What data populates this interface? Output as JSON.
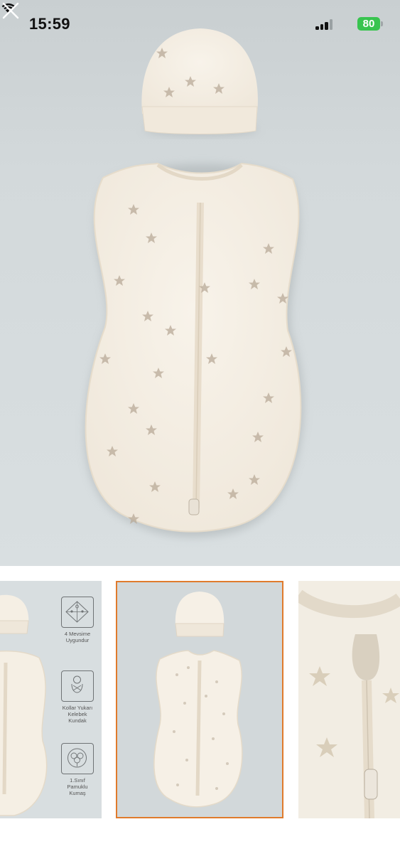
{
  "status_bar": {
    "time": "15:59",
    "battery_percent": "80",
    "signal_bars_active": 3,
    "signal_bars_total": 4
  },
  "header": {
    "close_icon": "close-icon"
  },
  "gallery": {
    "selected_index": 1,
    "accent_color": "#e07b2c",
    "thumbnails": [
      {
        "features": [
          {
            "icon": "four-seasons-icon",
            "label": "4 Mevsime Uygundur"
          },
          {
            "icon": "swaddled-baby-icon",
            "label": "Kollar Yukarı Kelebek Kundak"
          },
          {
            "icon": "cotton-icon",
            "label": "1.Sınıf Pamuklu Kumaş"
          }
        ]
      },
      {},
      {}
    ]
  }
}
